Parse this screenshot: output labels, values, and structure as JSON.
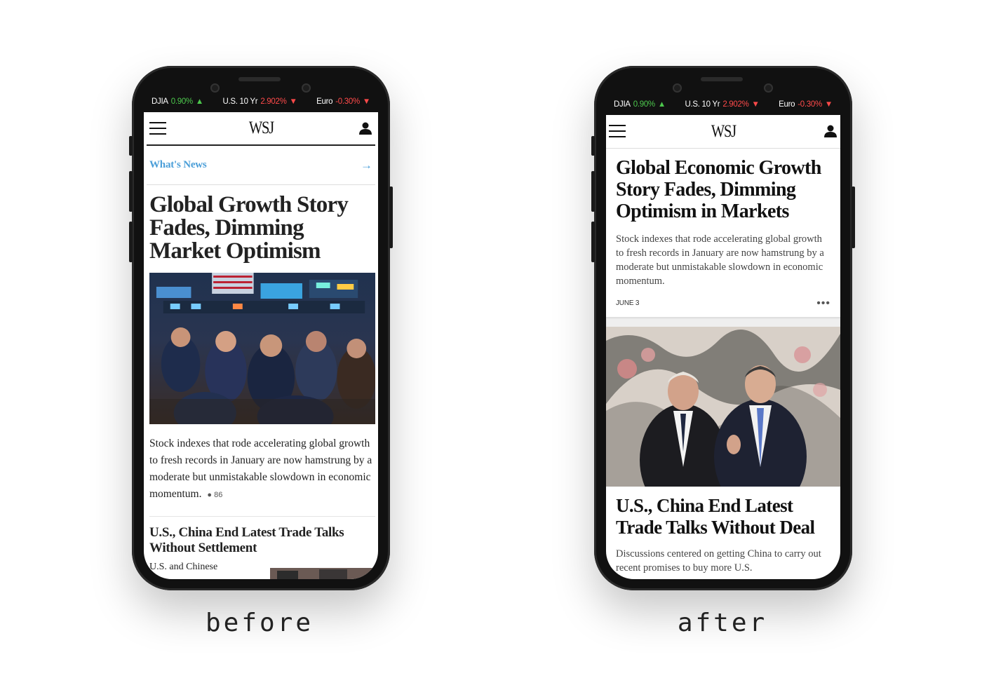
{
  "ticker": {
    "djia": {
      "name": "DJIA",
      "value": "0.90%",
      "direction": "up"
    },
    "us10yr": {
      "name": "U.S. 10 Yr",
      "value": "2.902%",
      "direction": "down"
    },
    "euro": {
      "name": "Euro",
      "value": "-0.30%",
      "direction": "down"
    }
  },
  "app": {
    "logo": "WSJ"
  },
  "before": {
    "section_label": "What's News",
    "headline": "Global Growth Story Fades, Dimming Market Optimism",
    "summary": "Stock indexes that rode accelerating global growth to fresh records in January are now hamstrung by a moderate but unmistakable slowdown in economic momentum.",
    "comment_count": "86",
    "second_headline": "U.S., China End Latest Trade Talks Without Settlement",
    "second_snippet": "U.S. and Chinese"
  },
  "after": {
    "headline": "Global Economic Growth Story Fades, Dimming Optimism in Markets",
    "summary": "Stock indexes that rode accelerating global growth to fresh records in January are now hamstrung by a moderate but unmistakable slowdown in economic momentum.",
    "date": "JUNE 3",
    "more": "•••",
    "second_headline": "U.S., China End Latest Trade Talks Without Deal",
    "second_snippet": "Discussions centered on getting China to carry out recent promises to buy more U.S."
  },
  "captions": {
    "before": "before",
    "after": "after"
  },
  "colors": {
    "accent_blue": "#4a9ed8",
    "ticker_up": "#4cc74c",
    "ticker_down": "#ff4a4a"
  },
  "icons": [
    "hamburger-menu-icon",
    "wsj-logo",
    "user-account-icon",
    "arrow-right-icon",
    "comment-bubble-icon",
    "more-options-icon"
  ]
}
